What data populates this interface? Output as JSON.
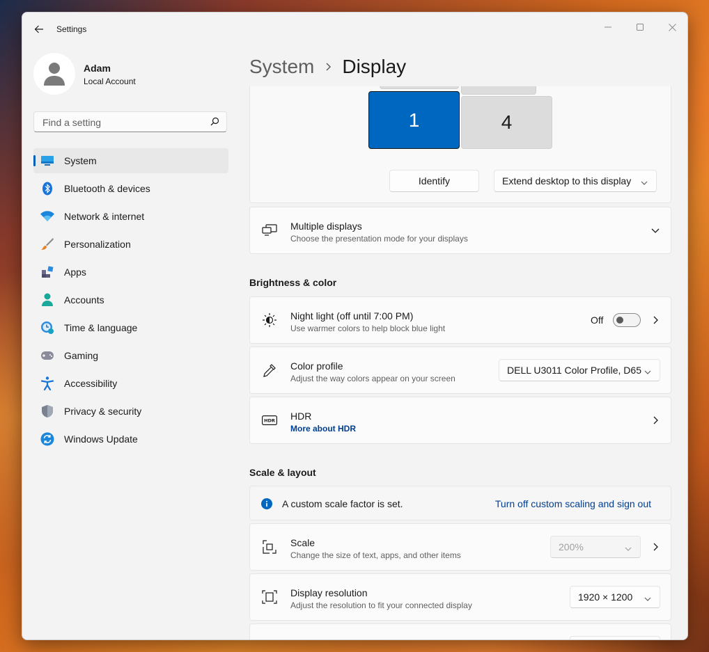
{
  "window": {
    "title": "Settings"
  },
  "profile": {
    "name": "Adam",
    "account_type": "Local Account"
  },
  "search": {
    "placeholder": "Find a setting"
  },
  "nav": {
    "items": [
      {
        "label": "System",
        "icon": "system-icon",
        "active": true
      },
      {
        "label": "Bluetooth & devices",
        "icon": "bluetooth-icon"
      },
      {
        "label": "Network & internet",
        "icon": "wifi-icon"
      },
      {
        "label": "Personalization",
        "icon": "brush-icon"
      },
      {
        "label": "Apps",
        "icon": "apps-icon"
      },
      {
        "label": "Accounts",
        "icon": "accounts-icon"
      },
      {
        "label": "Time & language",
        "icon": "time-language-icon"
      },
      {
        "label": "Gaming",
        "icon": "gamepad-icon"
      },
      {
        "label": "Accessibility",
        "icon": "accessibility-icon"
      },
      {
        "label": "Privacy & security",
        "icon": "shield-icon"
      },
      {
        "label": "Windows Update",
        "icon": "update-icon"
      }
    ]
  },
  "breadcrumb": {
    "parent": "System",
    "current": "Display"
  },
  "monitors": {
    "display_1": "1",
    "display_4": "4"
  },
  "monitor_actions": {
    "identify": "Identify",
    "mode": "Extend desktop to this display"
  },
  "multiple_displays": {
    "title": "Multiple displays",
    "subtitle": "Choose the presentation mode for your displays"
  },
  "brightness": {
    "section_title": "Brightness & color",
    "night_light": {
      "title": "Night light (off until 7:00 PM)",
      "subtitle": "Use warmer colors to help block blue light",
      "state": "Off"
    },
    "color_profile": {
      "title": "Color profile",
      "subtitle": "Adjust the way colors appear on your screen",
      "value": "DELL U3011 Color Profile, D65"
    },
    "hdr": {
      "title": "HDR",
      "link": "More about HDR"
    }
  },
  "scale_layout": {
    "section_title": "Scale & layout",
    "info": {
      "text": "A custom scale factor is set.",
      "link": "Turn off custom scaling and sign out"
    },
    "scale": {
      "title": "Scale",
      "subtitle": "Change the size of text, apps, and other items",
      "value": "200%"
    },
    "resolution": {
      "title": "Display resolution",
      "subtitle": "Adjust the resolution to fit your connected display",
      "value": "1920 × 1200"
    }
  },
  "colors": {
    "accent": "#005fb8",
    "selected_monitor": "#0067c0",
    "link": "#003e92"
  }
}
